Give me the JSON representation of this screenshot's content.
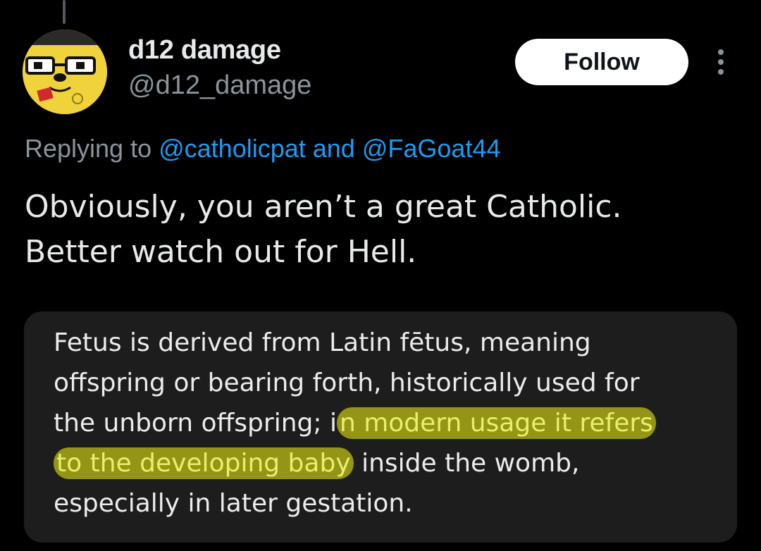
{
  "author": {
    "display_name": "d12 damage",
    "handle": "@d12_damage"
  },
  "actions": {
    "follow_label": "Follow",
    "more_icon": "more-vertical-icon"
  },
  "reply": {
    "prefix": "Replying to ",
    "mention1": "@catholicpat",
    "conjunction": " and ",
    "mention2": "@FaGoat44"
  },
  "tweet": {
    "line1": "Obviously, you aren’t a great Catholic.",
    "line2": "Better watch out for Hell."
  },
  "quote": {
    "line1": "Fetus is derived from Latin fētus, meaning",
    "line2": "offspring or bearing forth, historically used for",
    "line3_plain": "the unborn offspring; i",
    "line3_highlight": "n modern usage it refers",
    "line4_highlight": "to the developing baby",
    "line4_plain": " inside the womb,",
    "line5": "especially in later gestation."
  },
  "colors": {
    "background": "#000000",
    "text": "#e7e9ea",
    "muted": "#8b949b",
    "link": "#1d9bf0",
    "card": "#1d1d1d",
    "highlight": "#c7c814"
  }
}
